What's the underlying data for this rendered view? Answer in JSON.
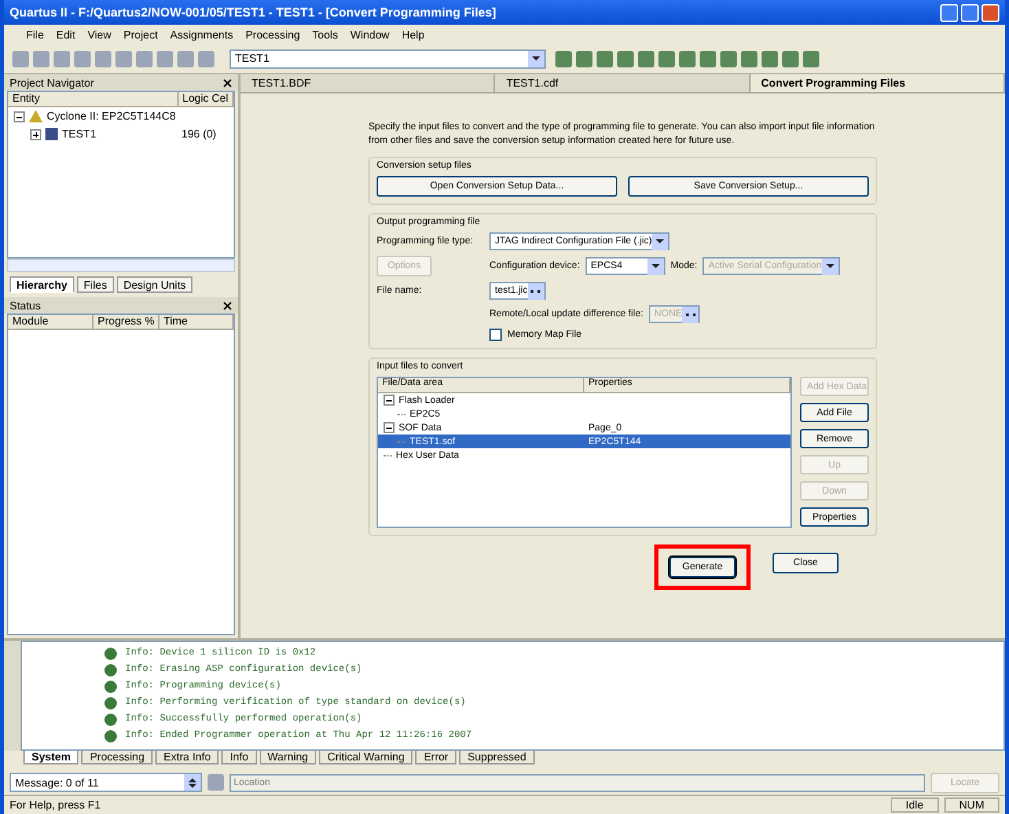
{
  "window": {
    "title": "Quartus II - F:/Quartus2/NOW-001/05/TEST1 - TEST1 - [Convert Programming Files]"
  },
  "menu": [
    "File",
    "Edit",
    "View",
    "Project",
    "Assignments",
    "Processing",
    "Tools",
    "Window",
    "Help"
  ],
  "toolbar": {
    "project_combo": "TEST1"
  },
  "project_navigator": {
    "title": "Project Navigator",
    "columns": [
      "Entity",
      "Logic Cel"
    ],
    "rows": [
      {
        "entity": "Cyclone II: EP2C5T144C8",
        "cells": "",
        "expanded": true,
        "children": [
          {
            "entity": "TEST1",
            "cells": "196 (0)",
            "expanded": false
          }
        ]
      }
    ],
    "tabs": [
      {
        "label": "Hierarchy",
        "selected": true
      },
      {
        "label": "Files",
        "selected": false
      },
      {
        "label": "Design Units",
        "selected": false
      }
    ]
  },
  "status_panel": {
    "title": "Status",
    "columns": [
      "Module",
      "Progress %",
      "Time"
    ]
  },
  "doc_tabs": [
    {
      "label": "TEST1.BDF",
      "selected": false
    },
    {
      "label": "TEST1.cdf",
      "selected": false
    },
    {
      "label": "Convert Programming Files",
      "selected": true
    }
  ],
  "convert": {
    "intro": [
      "Specify the input files to convert and the type of programming file to generate.",
      "You can also import input file information from other files and save the conversion setup information created here for future use."
    ],
    "setup_group": "Conversion setup files",
    "setup_buttons": [
      "Open Conversion Setup Data...",
      "Save Conversion Setup..."
    ],
    "output_group": "Output programming file",
    "file_type_label": "Programming file type:",
    "file_type": "JTAG Indirect Configuration File (.jic)",
    "options_button": {
      "label": "Options",
      "disabled": true
    },
    "device_label": "Configuration device:",
    "device": "EPCS4",
    "mode_label": "Mode:",
    "mode": "Active Serial Configuration",
    "mode_disabled": true,
    "file_name_label": "File name:",
    "file_name": "test1.jic",
    "diff_label": "Remote/Local update difference file:",
    "diff": "NONE",
    "diff_disabled": true,
    "memory_map": {
      "label": "Memory Map File",
      "checked": false
    },
    "input_group": "Input files to convert",
    "input_columns": [
      "File/Data area",
      "Properties"
    ],
    "input_rows": [
      {
        "name": "Flash Loader",
        "selected": false,
        "expanded": true,
        "children": [
          {
            "name": "EP2C5",
            "selected": false
          }
        ]
      },
      {
        "name": "SOF Data",
        "properties": "Page_0",
        "selected": false,
        "expanded": true,
        "children": [
          {
            "name": "TEST1.sof",
            "properties": "EP2C5T144",
            "selected": true
          }
        ]
      },
      {
        "name": "Hex User Data",
        "selected": false
      }
    ],
    "side_buttons": [
      {
        "label": "Add Hex Data",
        "disabled": true
      },
      {
        "label": "Add File",
        "disabled": false
      },
      {
        "label": "Remove",
        "disabled": false
      },
      {
        "label": "Up",
        "disabled": true
      },
      {
        "label": "Down",
        "disabled": true
      },
      {
        "label": "Properties",
        "disabled": false
      }
    ],
    "bottom_buttons": [
      {
        "label": "Generate",
        "highlighted": true
      },
      {
        "label": "Close",
        "highlighted": false
      }
    ]
  },
  "messages": {
    "lines": [
      "Info: Device 1 silicon ID is 0x12",
      "Info: Erasing ASP configuration device(s)",
      "Info: Programming device(s)",
      "Info: Performing verification of type standard on device(s)",
      "Info: Successfully performed operation(s)",
      "Info: Ended Programmer operation at Thu Apr 12 11:26:16 2007"
    ],
    "tabs": [
      {
        "label": "System",
        "selected": true
      },
      {
        "label": "Processing",
        "selected": false
      },
      {
        "label": "Extra Info",
        "selected": false
      },
      {
        "label": "Info",
        "selected": false
      },
      {
        "label": "Warning",
        "selected": false
      },
      {
        "label": "Critical Warning",
        "selected": false
      },
      {
        "label": "Error",
        "selected": false
      },
      {
        "label": "Suppressed",
        "selected": false
      }
    ],
    "counter": "Message: 0 of 11",
    "location": {
      "placeholder": "Location"
    },
    "locate": "Locate"
  },
  "status_bar": {
    "help": "For Help, press F1",
    "state": "Idle",
    "num": "NUM"
  }
}
